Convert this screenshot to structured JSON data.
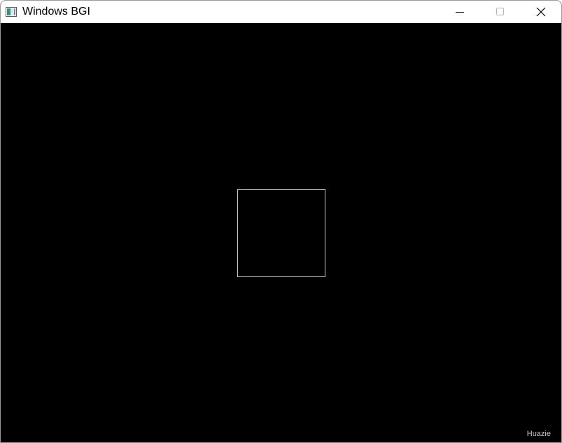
{
  "window": {
    "title": "Windows BGI",
    "app_icon": "bgi-window-icon",
    "controls": {
      "minimize_icon": "minimize-icon",
      "maximize_icon": "maximize-icon",
      "close_icon": "close-icon"
    }
  },
  "canvas": {
    "background_color": "#000000",
    "shape_outline_color": "#c8c8c8",
    "watermark": "Huazie"
  }
}
